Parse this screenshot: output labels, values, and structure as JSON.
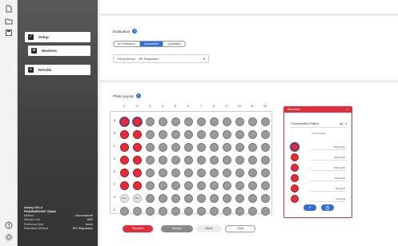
{
  "sidebar": {
    "items": [
      {
        "label": "Setup",
        "icon": "check-icon",
        "active": false
      },
      {
        "label": "Washers",
        "icon": "gear-icon",
        "active": true
      },
      {
        "label": "Results",
        "icon": "list-icon",
        "active": false
      }
    ],
    "meta": {
      "assay": "Assay 101-4",
      "kit": "PHARMIRON® XSafir",
      "rows": [
        {
          "label": "Method",
          "value": "Monochannel"
        },
        {
          "label": "Sample Unit",
          "value": "ABS"
        },
        {
          "label": "Reference Unit",
          "value": "Acrex"
        },
        {
          "label": "Evaluation Method",
          "value": "4PL Regression"
        }
      ]
    }
  },
  "evaluation": {
    "title": "Evaluation",
    "modes": [
      "No Evaluation",
      "Quantitative",
      "Qualitative"
    ],
    "selected_mode": "Quantitative",
    "fitting_label": "Fitting Method",
    "fitting_value": "4PL Regression"
  },
  "plate": {
    "title": "Plate Layout",
    "columns": [
      "1",
      "2",
      "3",
      "4",
      "5",
      "6",
      "7",
      "8",
      "9",
      "10",
      "11",
      "12"
    ],
    "rows": [
      "A",
      "B",
      "C",
      "D",
      "E",
      "F",
      "G",
      "H"
    ],
    "blank_label": "BLK",
    "buttons": {
      "standard": "Standard",
      "sample": "Sample",
      "blank": "Blank",
      "clear": "Clear"
    }
  },
  "standards": {
    "title": "Standards",
    "close": "×",
    "conc_label": "Concentration Pattern",
    "conc_value": "µg",
    "sub_label": "Concentration",
    "values": [
      "800 ng/ml",
      "400 ng/ml",
      "200 ng/ml",
      "100 ng/ml",
      "50 ng/ml",
      "25 ng/ml"
    ]
  },
  "colors": {
    "accent": "#2f6ed8",
    "standard": "#e22d3d",
    "empty": "#9a9a9a"
  }
}
